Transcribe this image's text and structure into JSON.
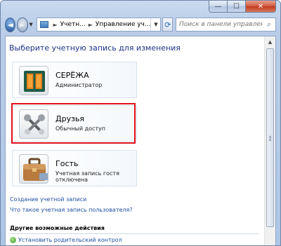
{
  "window": {
    "minimize": "—",
    "maximize": "☐",
    "close": "✕"
  },
  "nav": {
    "back_icon": "arrow-left",
    "forward_icon": "arrow-right",
    "breadcrumb": [
      "Учетн...",
      "Управление уч..."
    ],
    "search_placeholder": "Поиск в панели управления"
  },
  "page": {
    "title": "Выберите учетную запись для изменения"
  },
  "accounts": [
    {
      "name": "СЕРЁЖА",
      "type": "Администратор",
      "icon": "window-frame-avatar"
    },
    {
      "name": "Друзья",
      "type": "Обычный доступ",
      "icon": "tools-avatar"
    },
    {
      "name": "Гость",
      "type": "Учетная запись гостя отключена",
      "icon": "briefcase-avatar"
    }
  ],
  "links": {
    "create_account": "Создание учетной записи",
    "what_is_account": "Что такое учетная запись пользователя?"
  },
  "other": {
    "heading": "Другие возможные действия",
    "parental_control": "Установить родительский контрол"
  },
  "colors": {
    "highlight": "#e0101a",
    "title": "#1e3287",
    "link": "#1e4fa5"
  }
}
